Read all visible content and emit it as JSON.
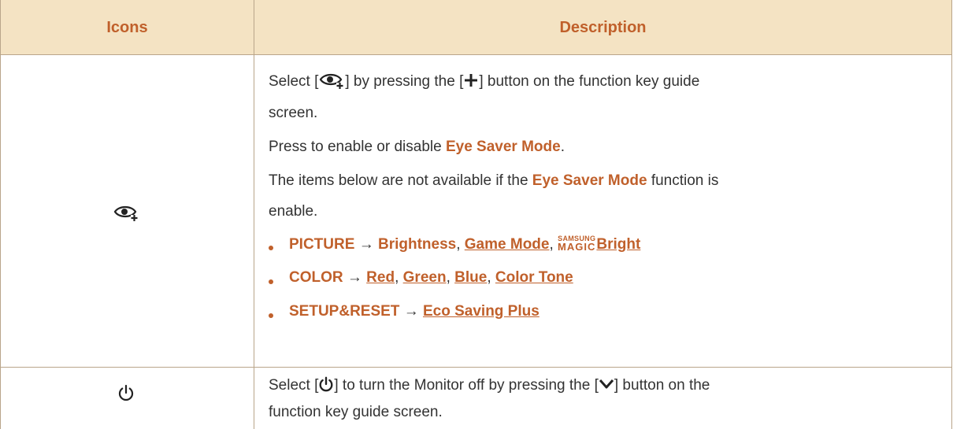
{
  "table": {
    "header": {
      "col1": "Icons",
      "col2": "Description"
    },
    "row1": {
      "icon": "eye-saver-icon",
      "line1_a": "Select [",
      "line1_b": "] by pressing the [",
      "line1_c": "] button on the function key guide",
      "line2": "screen.",
      "line3_a": "Press to enable or disable ",
      "line3_b": "Eye Saver Mode",
      "line3_c": ".",
      "line4_a": "The items below are not available if the ",
      "line4_b": "Eye Saver Mode",
      "line4_c": " function is",
      "line5": "enable.",
      "bullets": [
        {
          "menu": "PICTURE",
          "arrow": "→",
          "items": [
            "Brightness",
            "Game Mode",
            "Bright"
          ],
          "magic_top": "SAMSUNG",
          "magic_bottom": "MAGIC"
        },
        {
          "menu": "COLOR",
          "arrow": "→",
          "items": [
            "Red",
            "Green",
            "Blue",
            "Color Tone"
          ]
        },
        {
          "menu": "SETUP&RESET",
          "arrow": "→",
          "items": [
            "Eco Saving Plus"
          ]
        }
      ],
      "sep": ", "
    },
    "row2": {
      "icon": "power-icon",
      "line1_a": "Select [",
      "line1_b": "] to turn the Monitor off by pressing the [",
      "line1_c": "] button on the",
      "line2": "function key guide screen."
    }
  },
  "colors": {
    "accent": "#c0602b",
    "header_bg": "#f4e3c3",
    "border": "#b9a58a",
    "text": "#333333"
  }
}
